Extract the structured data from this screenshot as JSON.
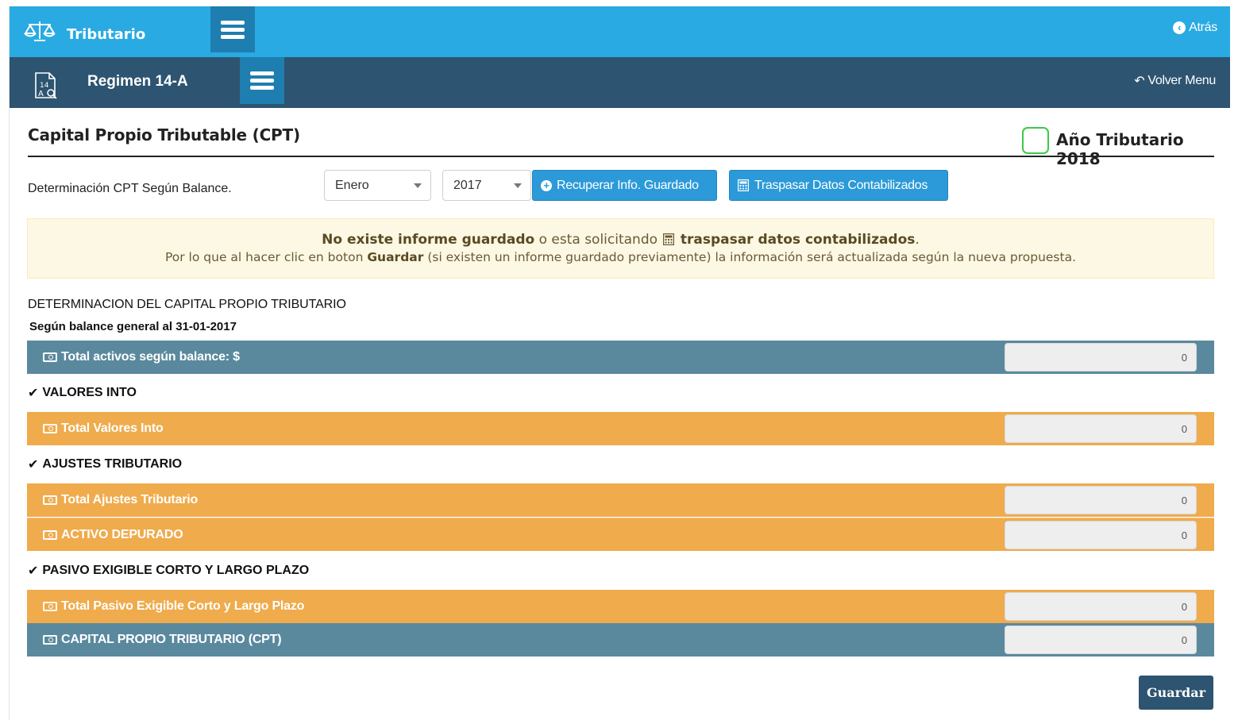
{
  "topbar": {
    "title": "Tributario",
    "back_label": "Atrás"
  },
  "subbar": {
    "title": "Regimen 14-A",
    "volver_label": "Volver Menu"
  },
  "page": {
    "title": "Capital Propio Tributable (CPT)",
    "year_label": "Año Tributario 2018"
  },
  "controls": {
    "det_label": "Determinación CPT Según Balance.",
    "month_selected": "Enero",
    "year_selected": "2017",
    "recuperar_label": "Recuperar Info. Guardado",
    "traspasar_label": "Traspasar Datos Contabilizados"
  },
  "alert": {
    "l1_bold1": "No existe informe guardado",
    "l1_text": " o esta solicitando ",
    "l1_bold2": "traspasar datos contabilizados",
    "l1_end": ".",
    "l2_a": "Por lo que al hacer clic en boton ",
    "l2_bold": "Guardar",
    "l2_b": " (si existen un informe guardado previamente) la información será actualizada según la nueva propuesta."
  },
  "section": {
    "title": "DETERMINACION DEL CAPITAL PROPIO TRIBUTARIO",
    "subtitle": "Según balance general al 31-01-2017"
  },
  "rows": [
    {
      "label": "Total activos según balance: $",
      "value": "0"
    },
    {
      "label": "Total Valores Into",
      "value": "0"
    },
    {
      "label": "Total Ajustes Tributario",
      "value": "0"
    },
    {
      "label": "ACTIVO DEPURADO",
      "value": "0"
    },
    {
      "label": "Total Pasivo Exigible Corto y Largo Plazo",
      "value": "0"
    },
    {
      "label": "CAPITAL PROPIO TRIBUTARIO (CPT)",
      "value": "0"
    }
  ],
  "groups": {
    "valores": "VALORES INTO",
    "ajustes": "AJUSTES TRIBUTARIO",
    "pasivo": "PASIVO EXIGIBLE CORTO Y LARGO PLAZO"
  },
  "footer": {
    "guardar_label": "Guardar"
  },
  "colors": {
    "topbar": "#29aae2",
    "subbar": "#2d5470",
    "row_blue": "#5a899e",
    "row_orange": "#efab4c",
    "accent_button": "#2c9ad8"
  },
  "icons": {
    "brand": "scales-icon",
    "menu": "hamburger-icon",
    "back": "circle-arrow-left-icon",
    "volver": "reply-arrow-icon",
    "doc": "document-14a-icon",
    "recuperar": "plus-circle-icon",
    "traspasar": "calculator-icon",
    "row": "money-icon",
    "check": "check-icon"
  }
}
